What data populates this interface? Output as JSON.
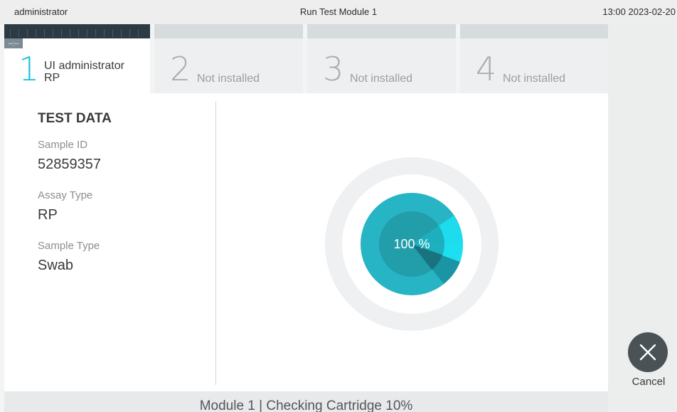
{
  "topbar": {
    "user": "administrator",
    "title": "Run Test Module 1",
    "clock": "13:00 2023-02-20"
  },
  "modules": [
    {
      "number": "1",
      "line1": "UI administrator",
      "line2": "RP",
      "timer": "--:--",
      "active": true
    },
    {
      "number": "2",
      "status": "Not installed"
    },
    {
      "number": "3",
      "status": "Not installed"
    },
    {
      "number": "4",
      "status": "Not installed"
    }
  ],
  "test_data": {
    "title": "TEST DATA",
    "sample_id_label": "Sample ID",
    "sample_id": "52859357",
    "assay_type_label": "Assay Type",
    "assay_type": "RP",
    "sample_type_label": "Sample Type",
    "sample_type": "Swab"
  },
  "progress": {
    "text": "100 %",
    "value": 1.0,
    "accent": "#1cc4d7"
  },
  "cancel": {
    "label": "Cancel",
    "icon": "close-icon"
  },
  "status_bar": {
    "text": "Module 1  |  Checking Cartridge 10%"
  }
}
